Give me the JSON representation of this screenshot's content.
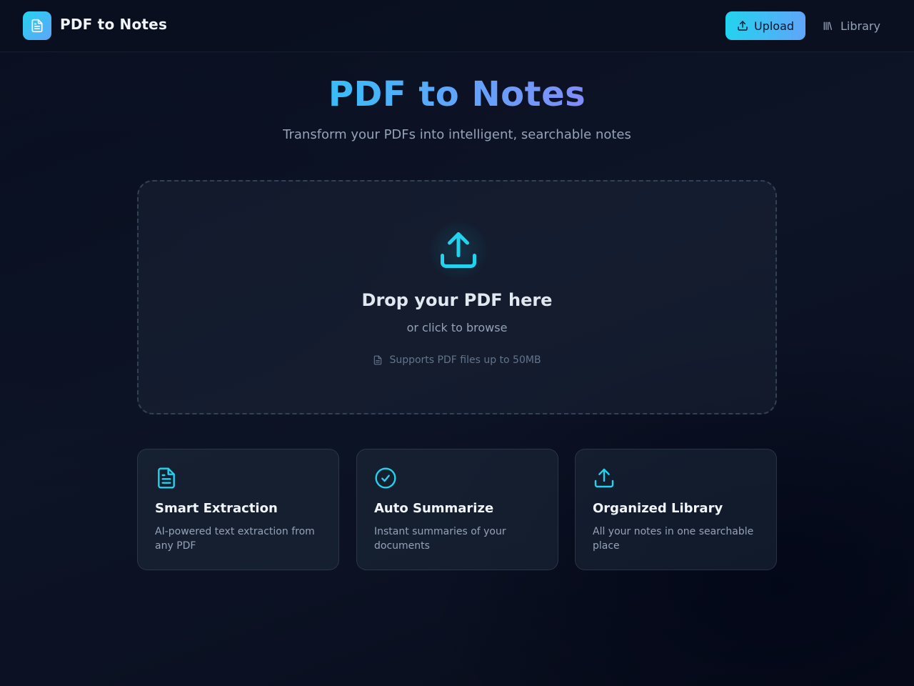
{
  "header": {
    "app_title": "PDF to Notes",
    "upload_label": "Upload",
    "library_label": "Library"
  },
  "hero": {
    "title": "PDF to Notes",
    "subtitle": "Transform your PDFs into intelligent, searchable notes"
  },
  "dropzone": {
    "title": "Drop your PDF here",
    "subtitle": "or click to browse",
    "note": "Supports PDF files up to 50MB"
  },
  "features": [
    {
      "icon": "file-text-icon",
      "title": "Smart Extraction",
      "description": "AI-powered text extraction from any PDF"
    },
    {
      "icon": "check-circle-icon",
      "title": "Auto Summarize",
      "description": "Instant summaries of your documents"
    },
    {
      "icon": "upload-icon",
      "title": "Organized Library",
      "description": "All your notes in one searchable place"
    }
  ],
  "colors": {
    "accent": "#22d3ee",
    "accent_secondary": "#60a5fa",
    "background": "#0b1120"
  }
}
